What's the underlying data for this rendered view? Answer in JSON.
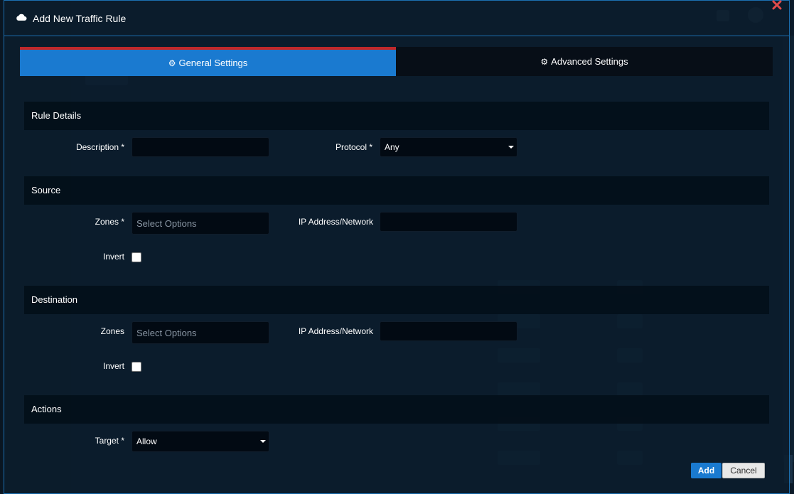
{
  "modal": {
    "title": "Add New Traffic Rule",
    "cloud_icon": "cloud-icon",
    "close_icon": "close-icon"
  },
  "tabs": [
    {
      "label": "General Settings",
      "icon": "gear-icon",
      "active": true
    },
    {
      "label": "Advanced Settings",
      "icon": "gears-icon",
      "active": false
    }
  ],
  "rule_details": {
    "heading": "Rule Details",
    "description_label": "Description *",
    "description_value": "",
    "protocol_label": "Protocol *",
    "protocol_value": "Any"
  },
  "source": {
    "heading": "Source",
    "zones_label": "Zones *",
    "zones_placeholder": "Select Options",
    "ip_label": "IP Address/Network",
    "ip_value": "",
    "invert_label": "Invert",
    "invert_checked": false
  },
  "destination": {
    "heading": "Destination",
    "zones_label": "Zones",
    "zones_placeholder": "Select Options",
    "ip_label": "IP Address/Network",
    "ip_value": "",
    "invert_label": "Invert",
    "invert_checked": false
  },
  "actions": {
    "heading": "Actions",
    "target_label": "Target *",
    "target_value": "Allow"
  },
  "footer": {
    "add_label": "Add",
    "cancel_label": "Cancel"
  },
  "colors": {
    "accent": "#1a7ad0",
    "active_tab_border": "#c0282a",
    "modal_border": "#1b6fb0"
  }
}
